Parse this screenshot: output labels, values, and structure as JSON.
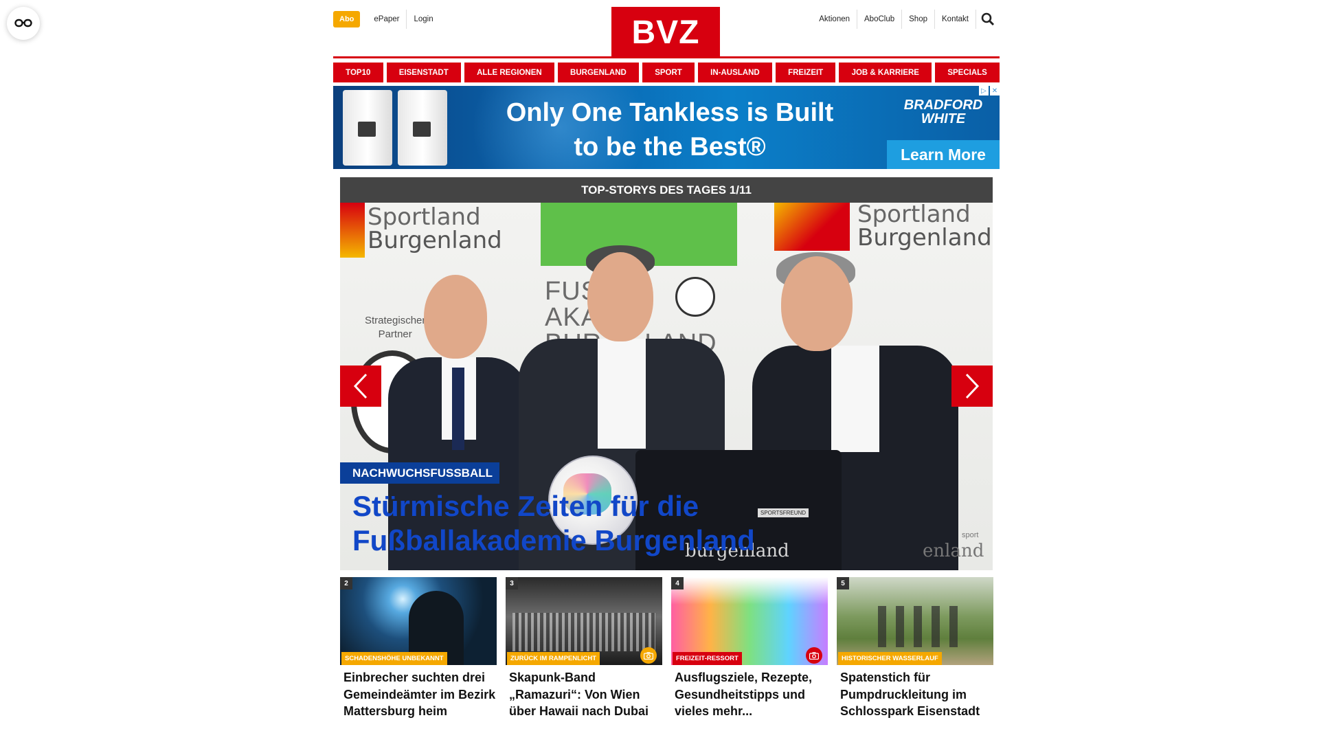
{
  "header": {
    "abo_label": "Abo",
    "left_links": [
      "ePaper",
      "Login"
    ],
    "logo_text": "BVZ",
    "right_links": [
      "Aktionen",
      "AboClub",
      "Shop",
      "Kontakt"
    ]
  },
  "nav": {
    "items": [
      "TOP10",
      "EISENSTADT",
      "ALLE REGIONEN",
      "BURGENLAND",
      "SPORT",
      "IN-AUSLAND",
      "FREIZEIT",
      "JOB & KARRIERE",
      "SPECIALS"
    ]
  },
  "ad": {
    "headline": "Only One Tankless is Built to be the Best®",
    "brand": "BRADFORD WHITE",
    "cta": "Learn More"
  },
  "top_stories": {
    "heading": "TOP-STORYS DES TAGES 1/11",
    "hero": {
      "kicker": "NACHWUCHSFUSSBALL",
      "title": "Stürmische Zeiten für die Fußballakademie Burgenland",
      "photo_text": {
        "sportland_left": [
          "Sportland",
          "Burgenland"
        ],
        "sportland_right": [
          "Sportland",
          "Burgenland"
        ],
        "akademie": [
          "FUSS",
          "AKA",
          "BUR",
          "LAND"
        ],
        "strat": [
          "Strategischer",
          "Partner"
        ],
        "jersey_label": "SPORTSFREUND",
        "jersey_logo": "burgenland",
        "right_logo": "enland",
        "right_sport": "sport"
      }
    }
  },
  "cards": [
    {
      "number": "2",
      "tag": "SCHADENSHÖHE UNBEKANNT",
      "title": "Einbrecher suchten drei Gemeindeämter im Bezirk Mattersburg heim",
      "tag_color": "#f5a800",
      "camera": false
    },
    {
      "number": "3",
      "tag": "ZURÜCK IM RAMPENLICHT",
      "title": "Skapunk-Band „Ramazuri“: Von Wien über Hawaii nach Dubai",
      "tag_color": "#f5a800",
      "camera": true,
      "camera_color": "#f5a800"
    },
    {
      "number": "4",
      "tag": "FREIZEIT-RESSORT",
      "title": "Ausflugsziele, Rezepte, Gesundheitstipps und vieles mehr...",
      "tag_color": "#d7000f",
      "camera": true,
      "camera_color": "#d7000f"
    },
    {
      "number": "5",
      "tag": "HISTORISCHER WASSERLAUF",
      "title": "Spatenstich für Pumpdruckleitung im Schlosspark Eisenstadt",
      "tag_color": "#f5a800",
      "camera": false
    }
  ],
  "colors": {
    "brand_red": "#d7000f",
    "abo_yellow": "#f5a800",
    "kicker_blue": "#0b3f99",
    "headline_blue": "#1147c8"
  }
}
